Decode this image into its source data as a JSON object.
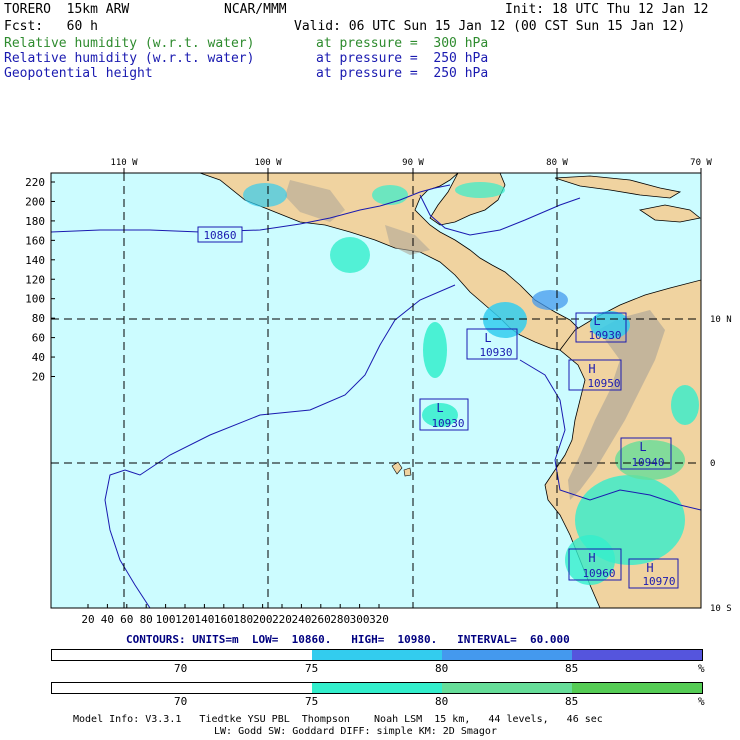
{
  "header": {
    "model": "TORERO  15km ARW",
    "org": "NCAR/MMM",
    "init": "Init: 18 UTC Thu 12 Jan 12",
    "fcst": "Fcst:   60 h",
    "valid": "Valid: 06 UTC Sun 15 Jan 12 (00 CST Sun 15 Jan 12)"
  },
  "fields": [
    {
      "name": "Relative humidity (w.r.t. water)",
      "level": "at pressure =  300 hPa",
      "color": "#2e8b2e"
    },
    {
      "name": "Relative humidity (w.r.t. water)",
      "level": "at pressure =  250 hPa",
      "color": "#1a1ab0"
    },
    {
      "name": "Geopotential height",
      "level": "at pressure =  250 hPa",
      "color": "#1a1ab0"
    }
  ],
  "map": {
    "lon_labels": [
      "110 W",
      "100 W",
      "90 W",
      "80 W",
      "70 W"
    ],
    "lat_labels": [
      "10 N",
      "0",
      "10 S"
    ],
    "y_ticks": [
      "220",
      "200",
      "180",
      "160",
      "140",
      "120",
      "100",
      "80",
      "60",
      "40",
      "20"
    ],
    "x_ticks": [
      "20",
      "40",
      "60",
      "80",
      "100",
      "120",
      "140",
      "160",
      "180",
      "200",
      "220",
      "240",
      "260",
      "280",
      "300",
      "320"
    ],
    "centers": [
      {
        "type": "",
        "value": "10860"
      },
      {
        "type": "L",
        "value": "10930"
      },
      {
        "type": "L",
        "value": "10930"
      },
      {
        "type": "L",
        "value": "10930"
      },
      {
        "type": "H",
        "value": "10950"
      },
      {
        "type": "L",
        "value": "10930"
      },
      {
        "type": "L",
        "value": "10940"
      },
      {
        "type": "H",
        "value": "10960"
      },
      {
        "type": "H",
        "value": "10970"
      }
    ]
  },
  "contours": {
    "prefix": "CONTOURS:",
    "units": "UNITS=m",
    "low": "LOW=  10860.",
    "high": "HIGH=  10980.",
    "interval": "INTERVAL=  60.000"
  },
  "colorbar_250": {
    "labels": [
      "70",
      "75",
      "80",
      "85",
      "%"
    ],
    "colors": [
      "#ffffff",
      "#33ccee",
      "#4499ee",
      "#5555dd"
    ]
  },
  "colorbar_300": {
    "labels": [
      "70",
      "75",
      "80",
      "85",
      "%"
    ],
    "colors": [
      "#ffffff",
      "#33eecc",
      "#66dd99",
      "#55cc55"
    ]
  },
  "footer": {
    "line1": "Model Info: V3.3.1   Tiedtke YSU PBL  Thompson    Noah LSM  15 km,   44 levels,   46 sec",
    "line2": "LW: Godd SW: Goddard DIFF: simple KM: 2D Smagor"
  }
}
